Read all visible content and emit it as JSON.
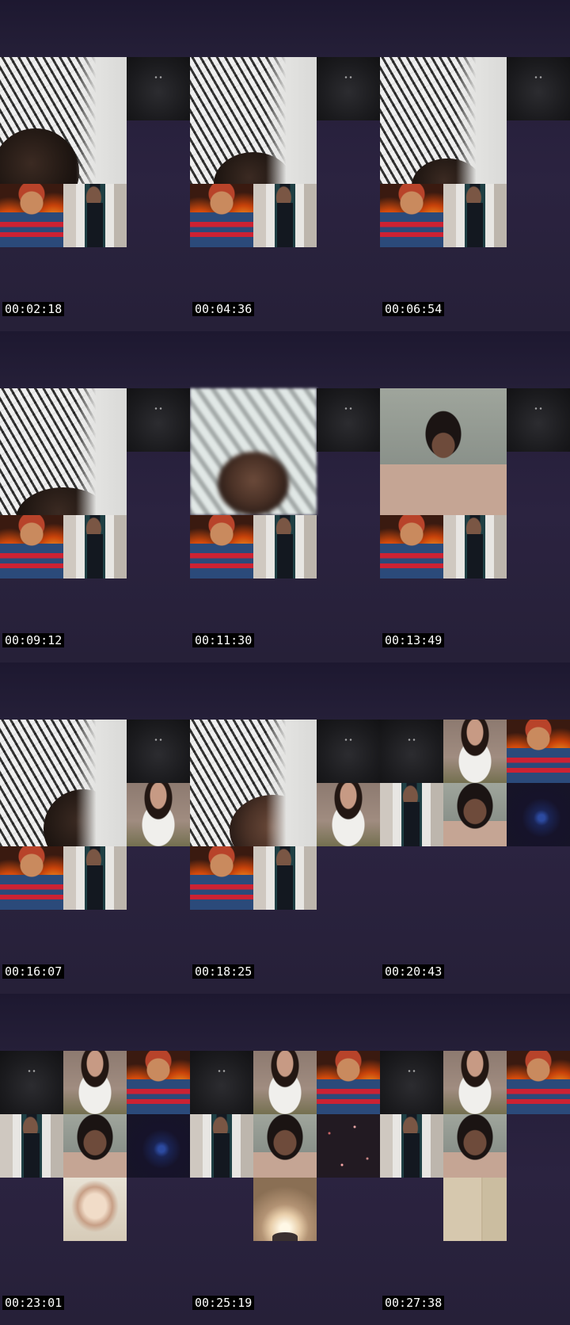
{
  "title": "",
  "thumbnails": [
    {
      "timestamp": "00:02:18"
    },
    {
      "timestamp": "00:04:36"
    },
    {
      "timestamp": "00:06:54"
    },
    {
      "timestamp": "00:09:12"
    },
    {
      "timestamp": "00:11:30"
    },
    {
      "timestamp": "00:13:49"
    },
    {
      "timestamp": "00:16:07"
    },
    {
      "timestamp": "00:18:25"
    },
    {
      "timestamp": "00:20:43"
    },
    {
      "timestamp": "00:23:01"
    },
    {
      "timestamp": "00:25:19"
    },
    {
      "timestamp": "00:27:38"
    }
  ]
}
